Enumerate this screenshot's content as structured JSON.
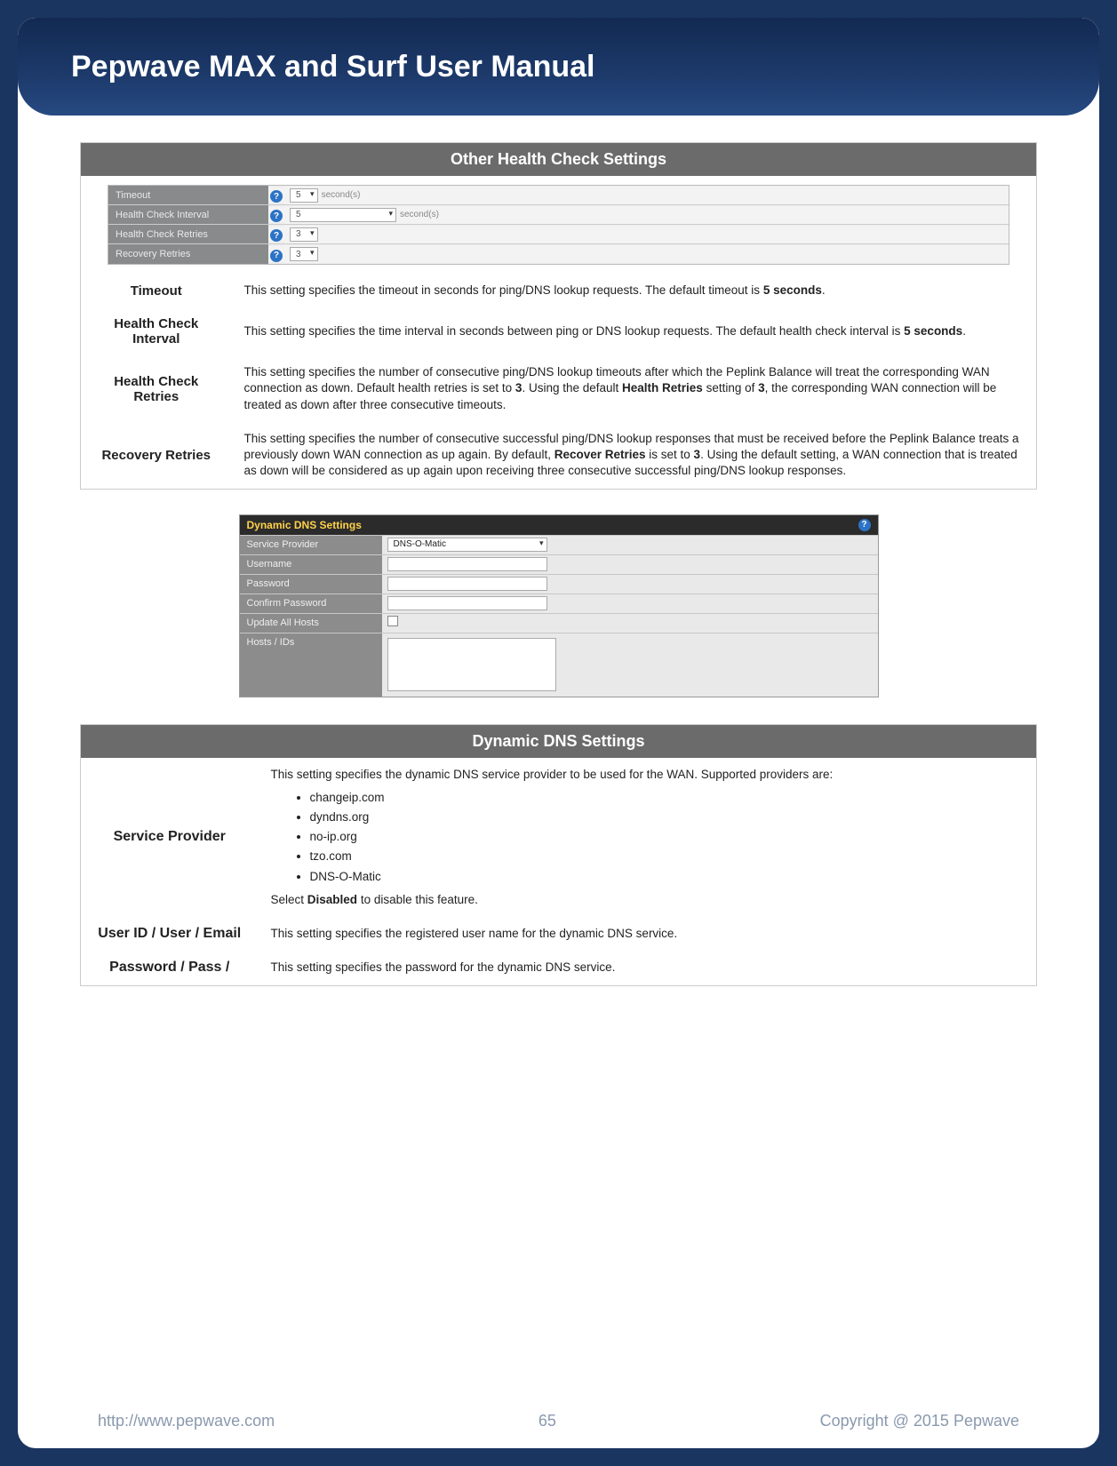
{
  "header": {
    "title": "Pepwave MAX and Surf User Manual"
  },
  "health_check_panel": {
    "section_title": "Other Health Check Settings",
    "rows": {
      "timeout": {
        "label": "Timeout",
        "value": "5",
        "unit": "second(s)"
      },
      "interval": {
        "label": "Health Check Interval",
        "value": "5",
        "unit": "second(s)"
      },
      "retries": {
        "label": "Health Check Retries",
        "value": "3"
      },
      "recovery": {
        "label": "Recovery Retries",
        "value": "3"
      }
    },
    "descriptions": {
      "timeout": {
        "label": "Timeout",
        "text_pre": "This setting specifies the timeout in seconds for ping/DNS lookup requests. The default timeout is ",
        "bold1": "5 seconds",
        "text_post": "."
      },
      "interval": {
        "label": "Health Check Interval",
        "text_pre": "This setting specifies the time interval in seconds between ping or DNS lookup requests. The default health check interval is ",
        "bold1": "5 seconds",
        "text_post": "."
      },
      "retries": {
        "label": "Health Check Retries",
        "text_pre": "This setting specifies the number of consecutive ping/DNS lookup timeouts after which the Peplink Balance will treat the corresponding WAN connection as down. Default health retries is set to ",
        "bold1": "3",
        "text_mid": ". Using the default ",
        "bold2": "Health Retries",
        "text_mid2": " setting of ",
        "bold3": "3",
        "text_post": ", the corresponding WAN connection will be treated as down after three consecutive  timeouts."
      },
      "recovery": {
        "label": "Recovery Retries",
        "text_pre": "This setting specifies the number of consecutive successful ping/DNS lookup responses that must be received before the Peplink Balance treats a previously down WAN connection as up again. By default, ",
        "bold1": "Recover Retries",
        "text_mid": " is set to ",
        "bold2": "3",
        "text_post": ". Using the default setting, a WAN connection that is treated as down will be considered as up again upon receiving three consecutive successful ping/DNS lookup responses."
      }
    }
  },
  "ddns_panel": {
    "title": "Dynamic DNS Settings",
    "rows": {
      "provider": {
        "label": "Service Provider",
        "value": "DNS-O-Matic"
      },
      "username": {
        "label": "Username"
      },
      "password": {
        "label": "Password"
      },
      "confirm": {
        "label": "Confirm Password"
      },
      "update": {
        "label": "Update All Hosts"
      },
      "hosts": {
        "label": "Hosts / IDs"
      }
    }
  },
  "ddns_desc": {
    "section_title": "Dynamic DNS Settings",
    "provider": {
      "label": "Service Provider",
      "intro": "This setting specifies the dynamic DNS service provider to be used for the WAN. Supported providers are:",
      "items": [
        "changeip.com",
        "dyndns.org",
        "no-ip.org",
        "tzo.com",
        "DNS-O-Matic"
      ],
      "outro_pre": "Select ",
      "outro_bold": "Disabled",
      "outro_post": " to disable this feature."
    },
    "user": {
      "label": "User ID / User / Email",
      "text": "This setting specifies the registered user name for the dynamic DNS service."
    },
    "password": {
      "label": "Password / Pass /",
      "text": "This setting specifies the password for the dynamic DNS service."
    }
  },
  "footer": {
    "url": "http://www.pepwave.com",
    "page": "65",
    "copyright": "Copyright @ 2015 Pepwave"
  }
}
